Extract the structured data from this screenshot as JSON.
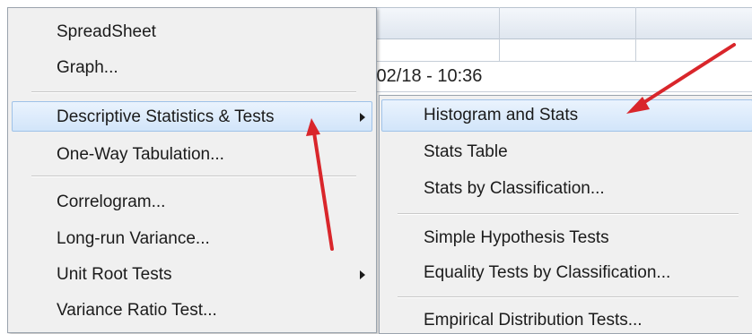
{
  "background": {
    "cell_text": "/02/18 - 10:36"
  },
  "menu": {
    "items": [
      {
        "label": "SpreadSheet"
      },
      {
        "label": "Graph..."
      },
      {
        "label": "Descriptive Statistics & Tests"
      },
      {
        "label": "One-Way Tabulation..."
      },
      {
        "label": "Correlogram..."
      },
      {
        "label": "Long-run Variance..."
      },
      {
        "label": "Unit Root Tests"
      },
      {
        "label": "Variance Ratio Test..."
      }
    ]
  },
  "submenu": {
    "items": [
      {
        "label": "Histogram and Stats"
      },
      {
        "label": "Stats Table"
      },
      {
        "label": "Stats by Classification..."
      },
      {
        "label": "Simple Hypothesis Tests"
      },
      {
        "label": "Equality Tests by Classification..."
      },
      {
        "label": "Empirical Distribution Tests..."
      }
    ]
  },
  "colors": {
    "highlight": "#d2e5fa",
    "menu_bg": "#f0f0f0",
    "annotation_arrow": "#d9262b"
  },
  "icons": [
    "submenu-arrow-icon",
    "annotation-arrow"
  ]
}
